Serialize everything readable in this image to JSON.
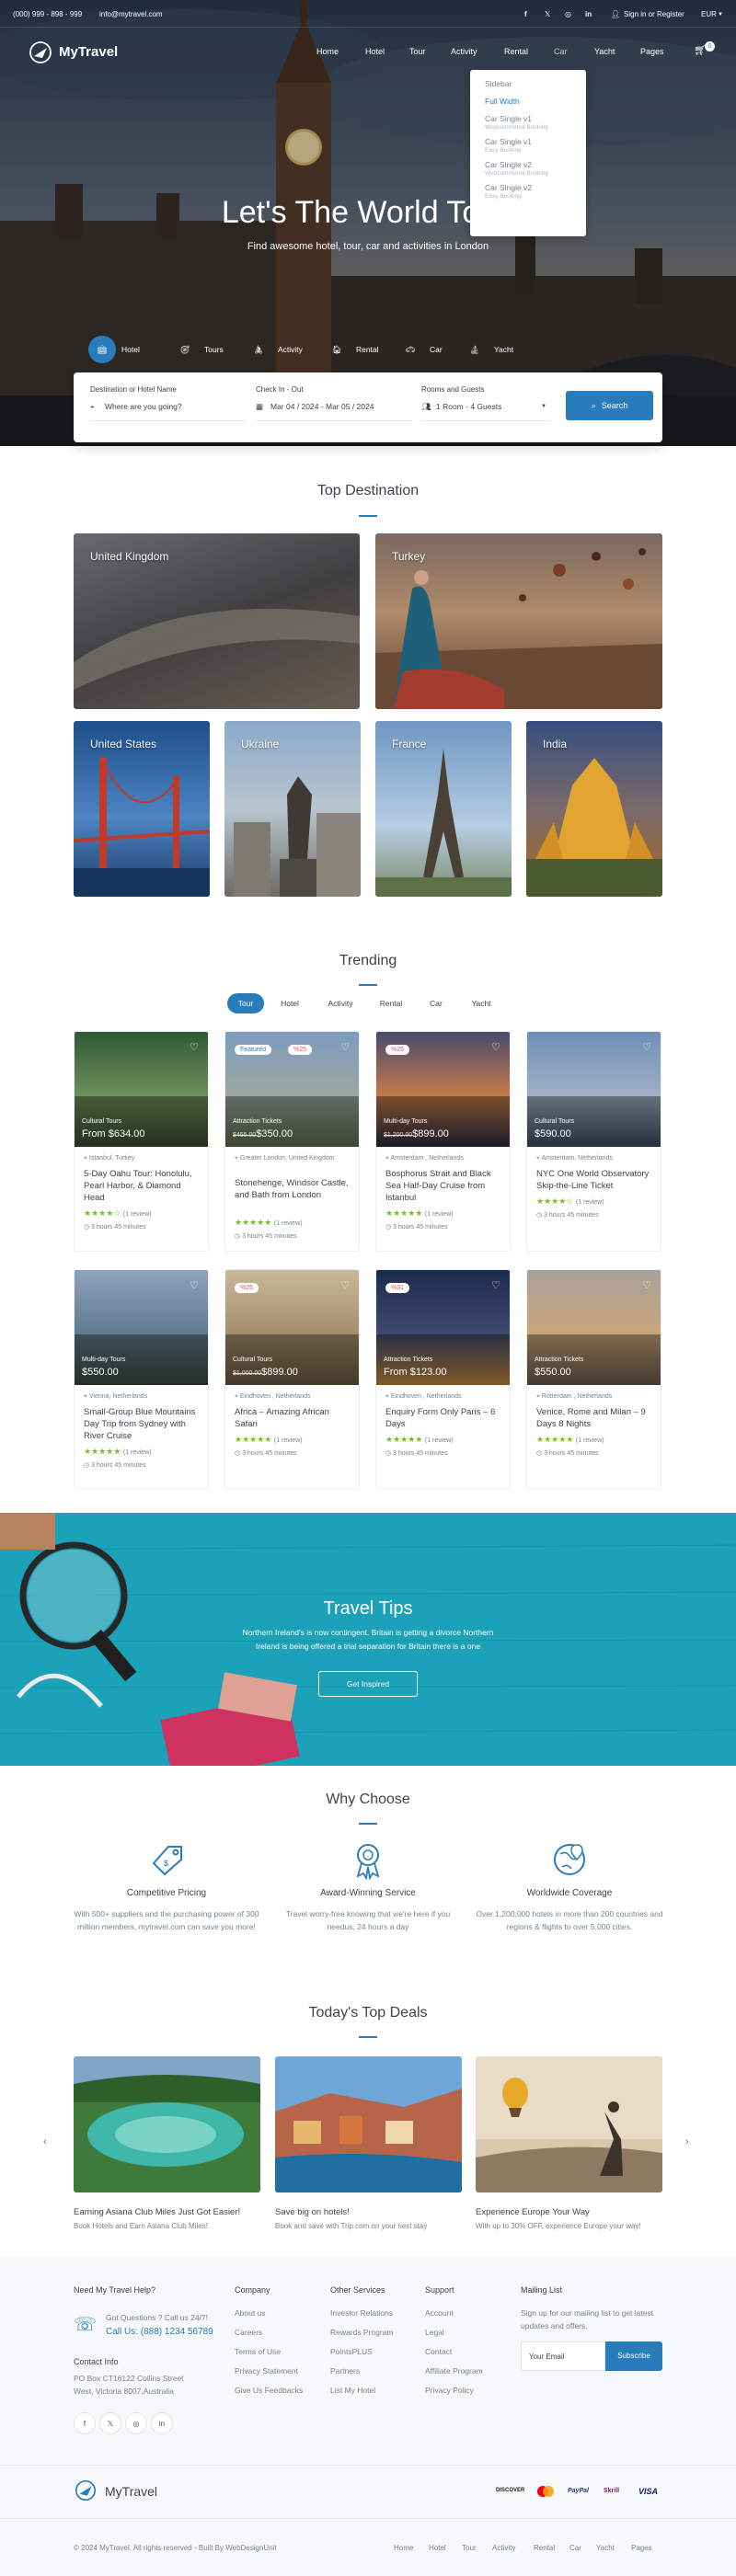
{
  "topbar": {
    "phone": "(000) 999 - 898 - 999",
    "email": "info@mytravel.com",
    "signin": "Sign in or Register",
    "currency": "EUR"
  },
  "nav": {
    "logo": "MyTravel",
    "items": [
      "Home",
      "Hotel",
      "Tour",
      "Activity",
      "Rental",
      "Car",
      "Yacht",
      "Pages"
    ],
    "cart_count": "0"
  },
  "dropdown": {
    "items": [
      {
        "label": "Sidebar",
        "sub": ""
      },
      {
        "label": "Full Width",
        "sub": ""
      },
      {
        "label": "Car Single v1",
        "sub": "Woocommerce Booking"
      },
      {
        "label": "Car Single v1",
        "sub": "Easy Booking"
      },
      {
        "label": "Car Single v2",
        "sub": "Woocommerce Booking"
      },
      {
        "label": "Car Single v2",
        "sub": "Easy Booking"
      }
    ]
  },
  "hero": {
    "title": "Let's The World Toge",
    "subtitle": "Find awesome hotel, tour, car and activities in London"
  },
  "search_tabs": [
    "Hotel",
    "Tours",
    "Activity",
    "Rental",
    "Car",
    "Yacht"
  ],
  "search": {
    "dest_label": "Destination or Hotel Name",
    "dest_placeholder": "Where are you going?",
    "date_label": "Check In - Out",
    "date_value": "Mar 04 / 2024 - Mar 05 / 2024",
    "rooms_label": "Rooms and Guests",
    "rooms_value": "1 Room - 4 Guests",
    "button": "Search"
  },
  "top_destination": {
    "title": "Top Destination",
    "items": [
      "United Kingdom",
      "Turkey",
      "United States",
      "Ukraine",
      "France",
      "India"
    ]
  },
  "trending": {
    "title": "Trending",
    "tabs": [
      "Tour",
      "Hotel",
      "Activity",
      "Rental",
      "Car",
      "Yacht"
    ],
    "cards": [
      {
        "category": "Cultural Tours",
        "price_prefix": "From",
        "old_price": "",
        "price": "$634.00",
        "badge": "",
        "location": "Istanbul, Turkey",
        "title": "5-Day Oahu Tour: Honolulu, Pearl Harbor, & Diamond Head",
        "stars": "★★★★☆",
        "reviews": "(1 review)",
        "duration": "3 hours 45 minutes"
      },
      {
        "category": "Attraction Tickets",
        "price_prefix": "",
        "old_price": "$455.00",
        "price": "$350.00",
        "badge": "Featured",
        "badge2": "%25",
        "location": "Greater London, United Kingdom",
        "title": "Stonehenge, Windsor Castle, and Bath from London",
        "stars": "★★★★★",
        "reviews": "(1 review)",
        "duration": "3 hours 45 minutes"
      },
      {
        "category": "Multi-day Tours",
        "price_prefix": "",
        "old_price": "$1,200.00",
        "price": "$899.00",
        "badge": "%25",
        "location": "Amsterdam , Netherlands",
        "title": "Bosphorus Strait and Black Sea Half-Day Cruise from Istanbul",
        "stars": "★★★★★",
        "reviews": "(1 review)",
        "duration": "3 hours 45 minutes"
      },
      {
        "category": "Cultural Tours",
        "price_prefix": "",
        "old_price": "",
        "price": "$590.00",
        "badge": "",
        "location": "Amsterdam, Netherlands",
        "title": "NYC One World Observatory Skip-the-Line Ticket",
        "stars": "★★★★☆",
        "reviews": "(1 review)",
        "duration": "3 hours 45 minutes"
      },
      {
        "category": "Multi-day Tours",
        "price_prefix": "",
        "old_price": "",
        "price": "$550.00",
        "badge": "",
        "location": "Vienna, Netherlands",
        "title": "Small-Group Blue Mountains Day Trip from Sydney with River Cruise",
        "stars": "★★★★★",
        "reviews": "(1 review)",
        "duration": "3 hours 45 minutes"
      },
      {
        "category": "Cultural Tours",
        "price_prefix": "",
        "old_price": "$1,000.00",
        "price": "$899.00",
        "badge": "%25",
        "location": "Eindhoven , Netherlands",
        "title": "Africa – Amazing African Safari",
        "stars": "★★★★★",
        "reviews": "(1 review)",
        "duration": "3 hours 45 minutes"
      },
      {
        "category": "Attraction Tickets",
        "price_prefix": "From",
        "old_price": "",
        "price": "$123.00",
        "badge": "%31",
        "location": "Eindhoven , Netherlands",
        "title": "Enquiry Form Only Paris – 6 Days",
        "stars": "★★★★★",
        "reviews": "(1 review)",
        "duration": "3 hours 45 minutes"
      },
      {
        "category": "Attraction Tickets",
        "price_prefix": "",
        "old_price": "",
        "price": "$550.00",
        "badge": "",
        "location": "Rotterdam , Netherlands",
        "title": "Venice, Rome and Milan – 9 Days 8 Nights",
        "stars": "★★★★★",
        "reviews": "(1 review)",
        "duration": "3 hours 45 minutes"
      }
    ]
  },
  "tips": {
    "title": "Travel Tips",
    "text1": "Northern Ireland's is now contingent. Britain is getting a divorce Northern",
    "text2": "Ireland is being offered a trial separation for Britain there is a one",
    "button": "Get Inspired"
  },
  "why": {
    "title": "Why Choose",
    "items": [
      {
        "title": "Competitive Pricing",
        "desc": "With 500+ suppliers and the purchasing power of 300 million members, mytravel.com can save you more!"
      },
      {
        "title": "Award-Winning Service",
        "desc": "Travel worry-free knowing that we're here if you needus, 24 hours a day"
      },
      {
        "title": "Worldwide Coverage",
        "desc": "Over 1,200,000 hotels in more than 200 countries and regions & flights to over 5,000 cities."
      }
    ]
  },
  "deals": {
    "title": "Today's Top Deals",
    "items": [
      {
        "title": "Earning Asiana Club Miles Just Got Easier!",
        "desc": "Book Hotels and Earn Asiana Club Miles!"
      },
      {
        "title": "Save big on hotels!",
        "desc": "Book and save with Trip.com on your next stay"
      },
      {
        "title": "Experience Europe Your Way",
        "desc": "With up to 30% OFF, experience Europe your way!"
      }
    ]
  },
  "footer": {
    "help_title": "Need My Travel Help?",
    "help_q": "Got Questions ? Call us 24/7!",
    "help_phone": "Call Us: (888) 1234 56789",
    "contact_title": "Contact Info",
    "address1": "PO Box CT16122 Collins Street",
    "address2": "West, Victoria 8007,Australia",
    "company_title": "Company",
    "company": [
      "About us",
      "Careers",
      "Terms of Use",
      "Privacy Statement",
      "Give Us Feedbacks"
    ],
    "services_title": "Other Services",
    "services": [
      "Investor Relations",
      "Rewards Program",
      "PointsPLUS",
      "Partners",
      "List My Hotel"
    ],
    "support_title": "Support",
    "support": [
      "Account",
      "Legal",
      "Contact",
      "Affiliate Program",
      "Privacy Policy"
    ],
    "mail_title": "Mailing List",
    "mail_text1": "Sign up for our mailing list to get latest",
    "mail_text2": "updates and offers.",
    "email_placeholder": "Your Email",
    "subscribe": "Subscribe",
    "logo": "MyTravel",
    "copyright": "© 2024 MyTravel. All rights reserved - Built By WebDesignUnit",
    "bottom_links": [
      "Home",
      "Hotel",
      "Tour",
      "Activity",
      "Rental",
      "Car",
      "Yacht",
      "Pages"
    ],
    "payments": [
      "DISCOVER",
      "mastercard",
      "PayPal",
      "Skrill",
      "VISA"
    ]
  },
  "colors": {
    "primary": "#297cbb",
    "star": "#7cba2a",
    "badge_red": "#e84a5f",
    "tips_bg": "#1fb3cc"
  }
}
